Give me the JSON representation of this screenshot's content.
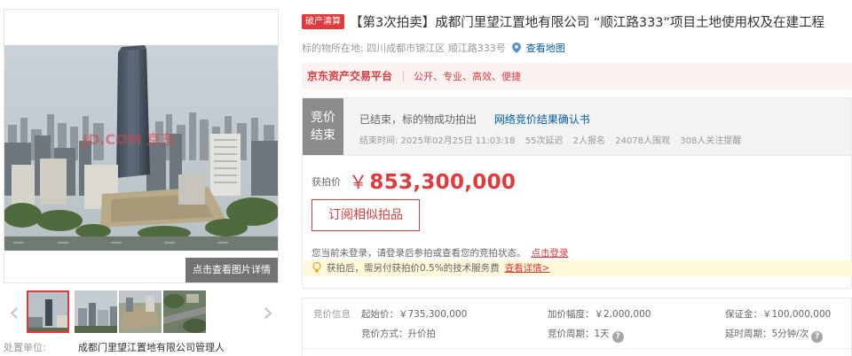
{
  "gallery": {
    "view_detail_label": "点击查看图片详情",
    "watermark": "JD.COM 京东",
    "prev_icon": "chevron-left-icon",
    "next_icon": "chevron-right-icon",
    "thumbnail_count": 4,
    "active_thumbnail": 1
  },
  "dispose": {
    "label": "处置单位:",
    "value": "成都门里望江置地有限公司管理人"
  },
  "header": {
    "badge": "破产清算",
    "title": "【第3次拍卖】成都门里望江置地有限公司 “顺江路333”项目土地使用权及在建工程"
  },
  "address": {
    "label": "标的物所在地:",
    "value": "四川成都市锦江区 顺江路333号",
    "map_link": "查看地图"
  },
  "platform": {
    "name": "京东资产交易平台",
    "slogan": "公开、专业、高效、便捷"
  },
  "status": {
    "tag_line1": "竞价",
    "tag_line2": "结束",
    "main": "已结束，标的物成功拍出",
    "result_link": "网络竞价结果确认书",
    "end_time": "结束时间:  2025年02月25日 11:03:18",
    "delays": "55次延迟",
    "signups": "2人报名",
    "views": "24078人围观",
    "watchers": "308人关注提醒"
  },
  "price": {
    "label": "获拍价",
    "currency": "￥",
    "amount": "853,300,000",
    "subscribe_button": "订阅相似拍品",
    "login_tip": "您当前未登录，请登录后参拍或查看您的竞拍状态。",
    "login_link": "点击登录",
    "fee_tip": "获拍后，需另付获拍价0.5%的技术服务费",
    "fee_link": "查看详情>"
  },
  "info": {
    "label": "竞价信息",
    "starting_price": "起始价：￥735,300,000",
    "increment": "加价幅度：￥2,000,000",
    "deposit": "保证金：￥100,000,000",
    "bid_method": "竞价方式：升价拍",
    "bid_period": "竞价周期：1天",
    "delay_period": "延时周期：5分钟/次"
  },
  "colors": {
    "accent": "#e4393c",
    "link": "#005ea7",
    "status_tag": "#8c8c8c",
    "fee_bar": "#fff8d9"
  }
}
